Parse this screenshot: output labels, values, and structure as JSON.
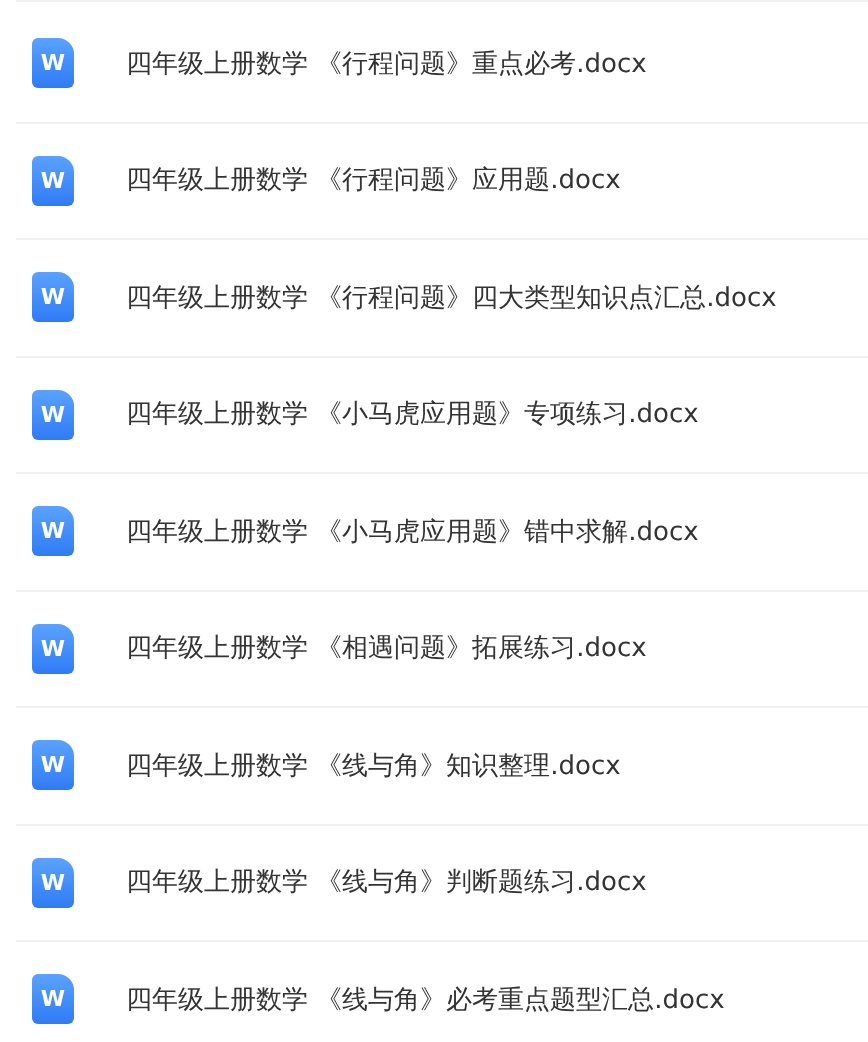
{
  "files": [
    {
      "icon_letter": "W",
      "name": "四年级上册数学 《行程问题》重点必考.docx"
    },
    {
      "icon_letter": "W",
      "name": "四年级上册数学 《行程问题》应用题.docx"
    },
    {
      "icon_letter": "W",
      "name": "四年级上册数学 《行程问题》四大类型知识点汇总.docx"
    },
    {
      "icon_letter": "W",
      "name": "四年级上册数学 《小马虎应用题》专项练习.docx"
    },
    {
      "icon_letter": "W",
      "name": "四年级上册数学 《小马虎应用题》错中求解.docx"
    },
    {
      "icon_letter": "W",
      "name": "四年级上册数学 《相遇问题》拓展练习.docx"
    },
    {
      "icon_letter": "W",
      "name": "四年级上册数学 《线与角》知识整理.docx"
    },
    {
      "icon_letter": "W",
      "name": "四年级上册数学 《线与角》判断题练习.docx"
    },
    {
      "icon_letter": "W",
      "name": "四年级上册数学 《线与角》必考重点题型汇总.docx"
    }
  ]
}
